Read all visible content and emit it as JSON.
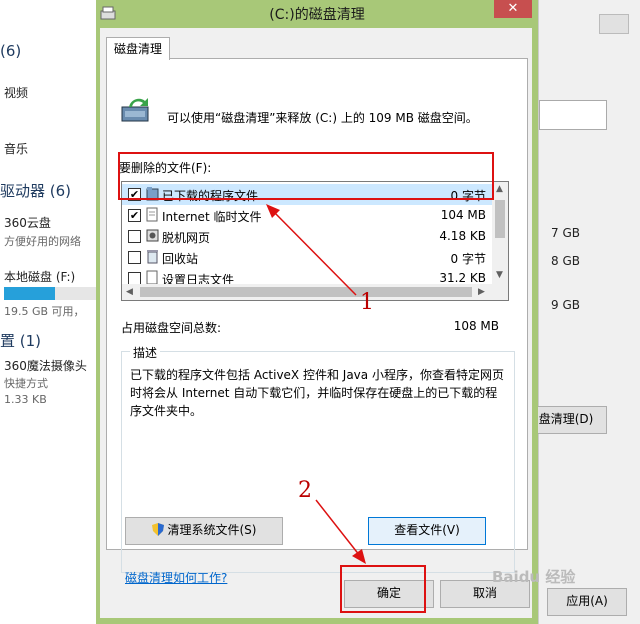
{
  "background": {
    "left_items": {
      "count_6": "(6)",
      "videos": "视频",
      "music": "音乐",
      "drives_header": "驱动器 (6)",
      "yun_name": "360云盘",
      "yun_desc": "方便好用的网络",
      "local_disk": "本地磁盘 (F:)",
      "local_free": "19.5 GB 可用，",
      "other_header": "置 (1)",
      "camera_name": "360魔法摄像头",
      "camera_type": "快捷方式",
      "camera_size": "1.33 KB"
    },
    "local_usage_fraction": 0.55,
    "right_items": {
      "r1": "7 GB",
      "r2": "8 GB",
      "r3": "9 GB",
      "cleanup_button": "盘清理(D)",
      "apply_button": "应用(A)"
    }
  },
  "dialog": {
    "title": "(C:)的磁盘清理",
    "close_glyph": "✕",
    "tab_label": "磁盘清理",
    "intro": "可以使用“磁盘清理”来释放 (C:) 上的 109 MB 磁盘空间。",
    "files_label": "要删除的文件(F):",
    "files": [
      {
        "name": "已下载的程序文件",
        "size": "0 字节",
        "checked": true,
        "selected": true
      },
      {
        "name": "Internet 临时文件",
        "size": "104 MB",
        "checked": true,
        "selected": false
      },
      {
        "name": "脱机网页",
        "size": "4.18 KB",
        "checked": false,
        "selected": false
      },
      {
        "name": "回收站",
        "size": "0 字节",
        "checked": false,
        "selected": false
      },
      {
        "name": "设置日志文件",
        "size": "31.2 KB",
        "checked": false,
        "selected": false
      }
    ],
    "total_label": "占用磁盘空间总数:",
    "total_value": "108 MB",
    "desc_title": "描述",
    "desc_text": "已下载的程序文件包括 ActiveX 控件和 Java 小程序，你查看特定网页时将会从 Internet 自动下载它们，并临时保存在硬盘上的已下载的程序文件夹中。",
    "clean_system_button": "清理系统文件(S)",
    "view_files_button": "查看文件(V)",
    "help_link": "磁盘清理如何工作?",
    "ok_button": "确定",
    "cancel_button": "取消"
  },
  "annotations": {
    "label_1": "1",
    "label_2": "2",
    "color": "#d11111"
  },
  "watermark": "Baidu 经验"
}
